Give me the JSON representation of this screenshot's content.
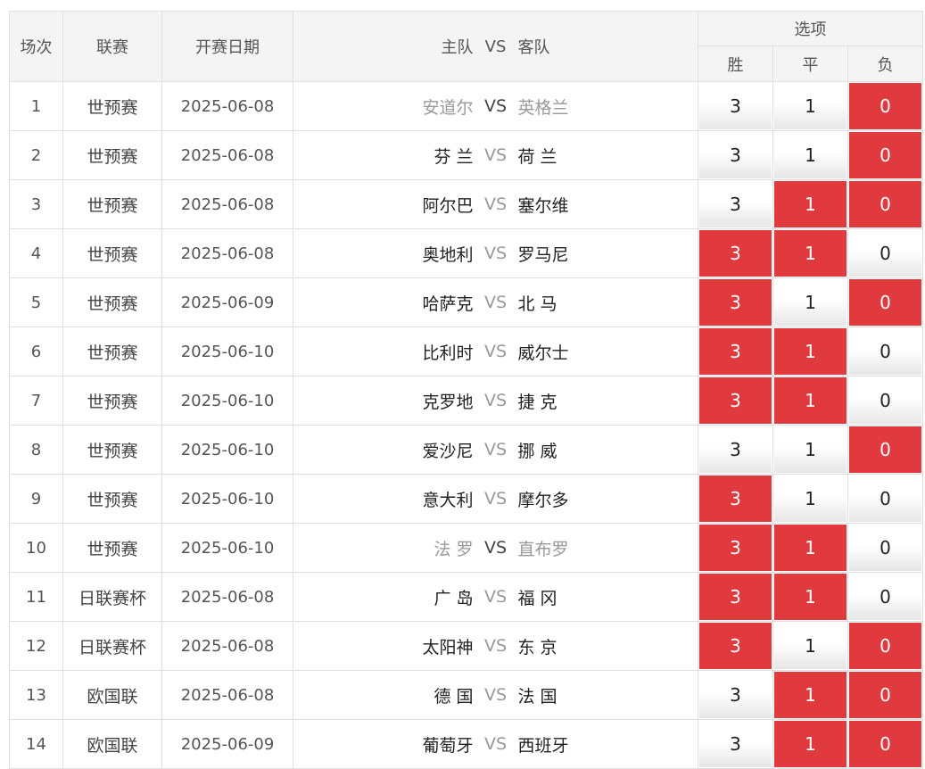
{
  "header": {
    "no": "场次",
    "league": "联赛",
    "date": "开赛日期",
    "home_label": "主队",
    "vs_label": "VS",
    "away_label": "客队",
    "options": "选项",
    "win": "胜",
    "draw": "平",
    "loss": "负"
  },
  "colors": {
    "selected": "#e03a3e",
    "header_bg": "#f4f4f4",
    "border": "#e0e0e0"
  },
  "rows": [
    {
      "no": "1",
      "league": "世预赛",
      "date": "2025-06-08",
      "home": "安道尔",
      "vs": "VS",
      "away": "英格兰",
      "win": "3",
      "draw": "1",
      "loss": "0",
      "sel": [
        false,
        false,
        true
      ],
      "muted": true
    },
    {
      "no": "2",
      "league": "世预赛",
      "date": "2025-06-08",
      "home": "芬 兰",
      "vs": "VS",
      "away": "荷 兰",
      "win": "3",
      "draw": "1",
      "loss": "0",
      "sel": [
        false,
        false,
        true
      ],
      "muted": false
    },
    {
      "no": "3",
      "league": "世预赛",
      "date": "2025-06-08",
      "home": "阿尔巴",
      "vs": "VS",
      "away": "塞尔维",
      "win": "3",
      "draw": "1",
      "loss": "0",
      "sel": [
        false,
        true,
        true
      ],
      "muted": false
    },
    {
      "no": "4",
      "league": "世预赛",
      "date": "2025-06-08",
      "home": "奥地利",
      "vs": "VS",
      "away": "罗马尼",
      "win": "3",
      "draw": "1",
      "loss": "0",
      "sel": [
        true,
        true,
        false
      ],
      "muted": false
    },
    {
      "no": "5",
      "league": "世预赛",
      "date": "2025-06-09",
      "home": "哈萨克",
      "vs": "VS",
      "away": "北 马",
      "win": "3",
      "draw": "1",
      "loss": "0",
      "sel": [
        true,
        false,
        true
      ],
      "muted": false
    },
    {
      "no": "6",
      "league": "世预赛",
      "date": "2025-06-10",
      "home": "比利时",
      "vs": "VS",
      "away": "威尔士",
      "win": "3",
      "draw": "1",
      "loss": "0",
      "sel": [
        true,
        true,
        false
      ],
      "muted": false
    },
    {
      "no": "7",
      "league": "世预赛",
      "date": "2025-06-10",
      "home": "克罗地",
      "vs": "VS",
      "away": "捷 克",
      "win": "3",
      "draw": "1",
      "loss": "0",
      "sel": [
        true,
        true,
        false
      ],
      "muted": false
    },
    {
      "no": "8",
      "league": "世预赛",
      "date": "2025-06-10",
      "home": "爱沙尼",
      "vs": "VS",
      "away": "挪 威",
      "win": "3",
      "draw": "1",
      "loss": "0",
      "sel": [
        false,
        false,
        true
      ],
      "muted": false
    },
    {
      "no": "9",
      "league": "世预赛",
      "date": "2025-06-10",
      "home": "意大利",
      "vs": "VS",
      "away": "摩尔多",
      "win": "3",
      "draw": "1",
      "loss": "0",
      "sel": [
        true,
        false,
        false
      ],
      "muted": false
    },
    {
      "no": "10",
      "league": "世预赛",
      "date": "2025-06-10",
      "home": "法 罗",
      "vs": "VS",
      "away": "直布罗",
      "win": "3",
      "draw": "1",
      "loss": "0",
      "sel": [
        true,
        true,
        false
      ],
      "muted": true
    },
    {
      "no": "11",
      "league": "日联赛杯",
      "date": "2025-06-08",
      "home": "广 岛",
      "vs": "VS",
      "away": "福 冈",
      "win": "3",
      "draw": "1",
      "loss": "0",
      "sel": [
        true,
        true,
        false
      ],
      "muted": false
    },
    {
      "no": "12",
      "league": "日联赛杯",
      "date": "2025-06-08",
      "home": "太阳神",
      "vs": "VS",
      "away": "东 京",
      "win": "3",
      "draw": "1",
      "loss": "0",
      "sel": [
        true,
        false,
        true
      ],
      "muted": false
    },
    {
      "no": "13",
      "league": "欧国联",
      "date": "2025-06-08",
      "home": "德 国",
      "vs": "VS",
      "away": "法 国",
      "win": "3",
      "draw": "1",
      "loss": "0",
      "sel": [
        false,
        true,
        true
      ],
      "muted": false
    },
    {
      "no": "14",
      "league": "欧国联",
      "date": "2025-06-09",
      "home": "葡萄牙",
      "vs": "VS",
      "away": "西班牙",
      "win": "3",
      "draw": "1",
      "loss": "0",
      "sel": [
        false,
        true,
        true
      ],
      "muted": false
    }
  ]
}
